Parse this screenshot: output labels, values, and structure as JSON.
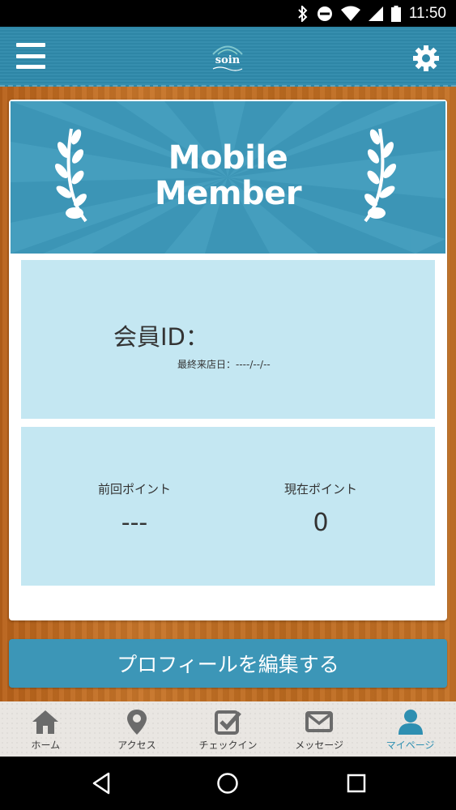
{
  "status_bar": {
    "time": "11:50",
    "icons": [
      "bluetooth-icon",
      "do-not-disturb-icon",
      "wifi-icon",
      "signal-icon",
      "battery-icon"
    ]
  },
  "header": {
    "logo_text": "soin",
    "menu_icon": "hamburger-menu-icon",
    "settings_icon": "gear-icon",
    "color": "#2f8aab"
  },
  "card": {
    "banner_title_line1": "Mobile",
    "banner_title_line2": "Member",
    "banner_color": "#3c95b6",
    "member_id_label": "会員ID：",
    "last_visit": "最終来店日：----/--/--",
    "previous_points_label": "前回ポイント",
    "previous_points_value": "---",
    "current_points_label": "現在ポイント",
    "current_points_value": "0"
  },
  "edit_profile_button": "プロフィールを編集する",
  "tabs": [
    {
      "label": "ホーム",
      "icon": "home-icon",
      "active": false
    },
    {
      "label": "アクセス",
      "icon": "map-pin-icon",
      "active": false
    },
    {
      "label": "チェックイン",
      "icon": "checkbox-icon",
      "active": false
    },
    {
      "label": "メッセージ",
      "icon": "envelope-icon",
      "active": false
    },
    {
      "label": "マイページ",
      "icon": "person-icon",
      "active": true
    }
  ],
  "nav_bar": {
    "icons": [
      "back-icon",
      "home-circle-icon",
      "recents-icon"
    ]
  },
  "colors": {
    "accent": "#2e8fb1",
    "panel": "#c4e7f2",
    "wood": "#c06a1f"
  }
}
